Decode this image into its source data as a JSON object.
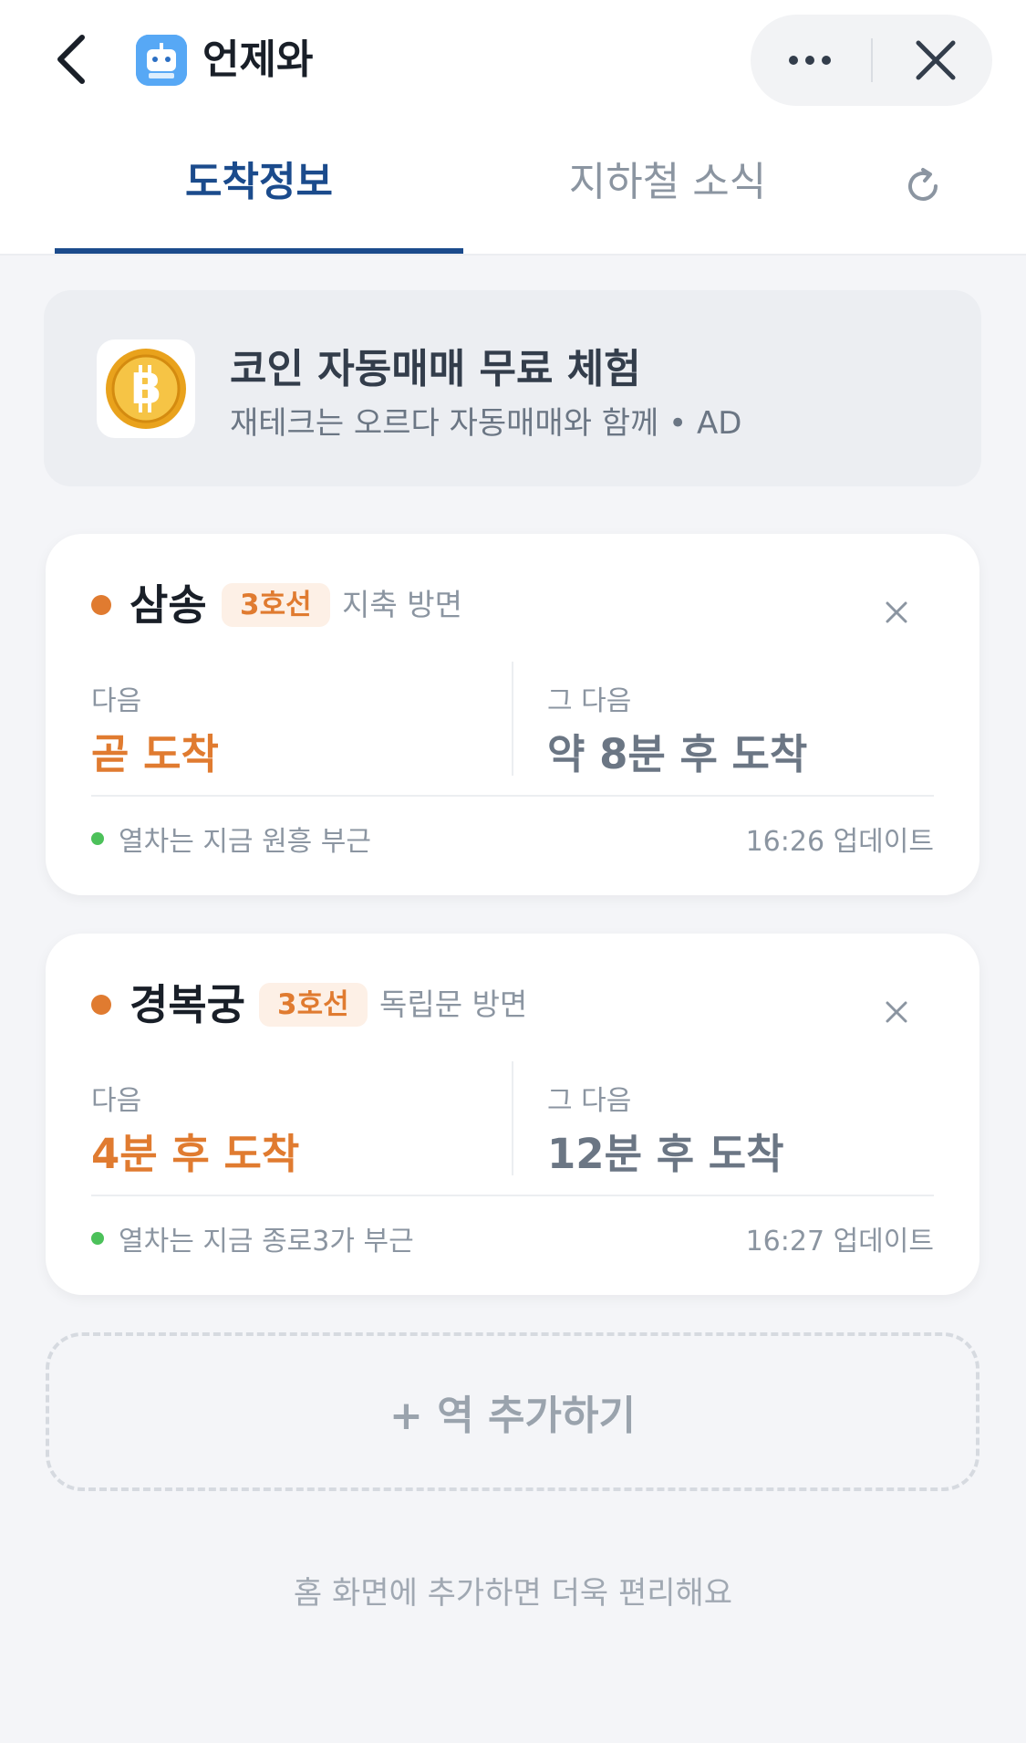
{
  "header": {
    "app_title": "언제와",
    "app_icon_label": "언제와",
    "icons": {
      "back": "chevron-left-icon",
      "more": "more-horizontal-icon",
      "close": "close-icon",
      "refresh": "refresh-icon"
    }
  },
  "tabs": [
    {
      "label": "도착정보",
      "active": true
    },
    {
      "label": "지하철 소식",
      "active": false
    }
  ],
  "ad": {
    "title": "코인 자동매매 무료 체험",
    "subtitle": "재테크는 오르다 자동매매와 함께 • AD",
    "icon": "bitcoin-coin-icon"
  },
  "stations": [
    {
      "name": "삼송",
      "line": "3호선",
      "direction": "지축 방면",
      "next_label": "다음",
      "next_value": "곧 도착",
      "after_label": "그 다음",
      "after_value": "약 8분 후 도착",
      "status": "열차는 지금 원흥 부근",
      "updated": "16:26 업데이트"
    },
    {
      "name": "경복궁",
      "line": "3호선",
      "direction": "독립문 방면",
      "next_label": "다음",
      "next_value": "4분 후 도착",
      "after_label": "그 다음",
      "after_value": "12분 후 도착",
      "status": "열차는 지금 종로3가 부근",
      "updated": "16:27 업데이트"
    }
  ],
  "add_station_label": "+ 역 추가하기",
  "footer_hint": "홈 화면에 추가하면 더욱 편리해요",
  "colors": {
    "accent_blue": "#1b4b8c",
    "line3_orange": "#e07b30",
    "live_green": "#4cc15a",
    "background": "#f4f5f8"
  }
}
